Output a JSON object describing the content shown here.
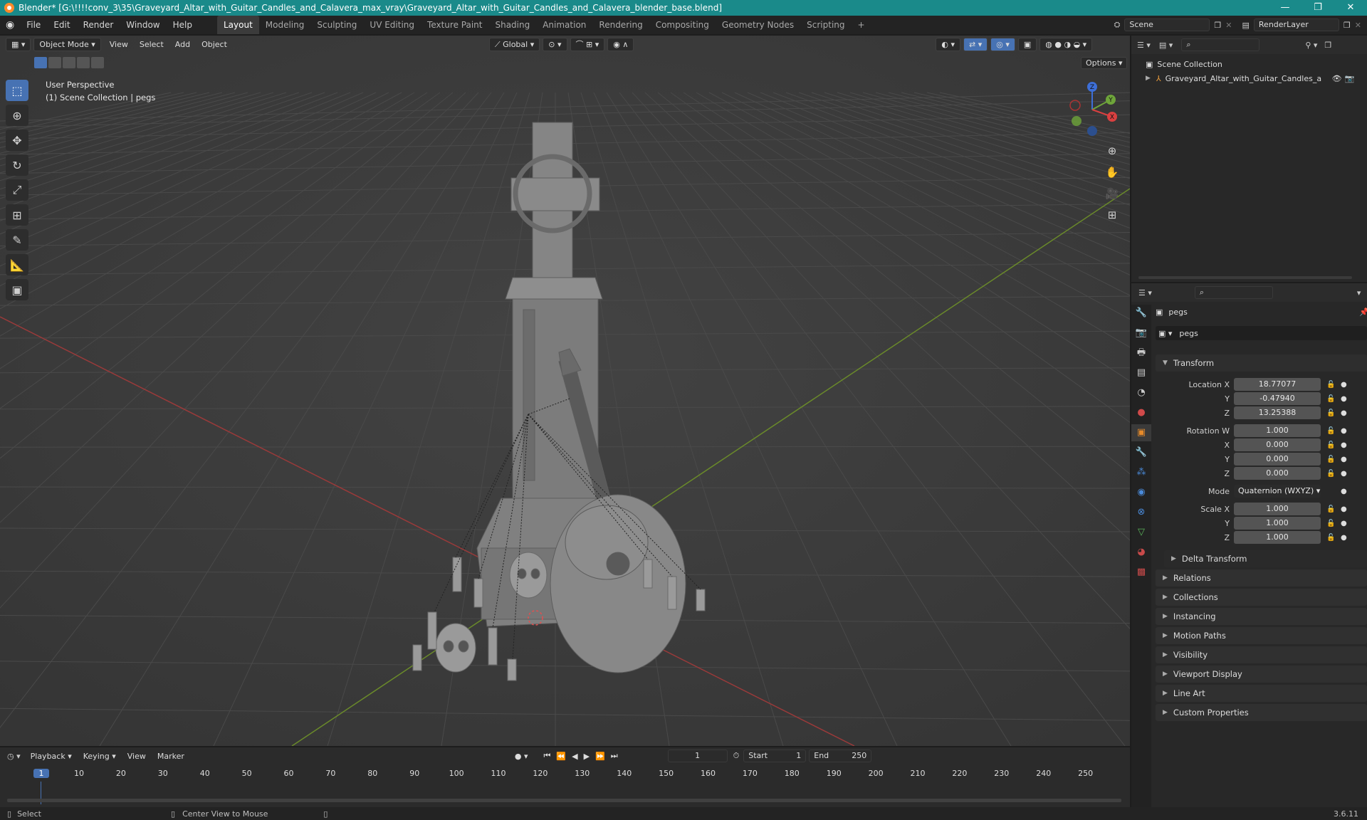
{
  "titlebar": {
    "title": "Blender* [G:\\!!!!conv_3\\35\\Graveyard_Altar_with_Guitar_Candles_and_Calavera_max_vray\\Graveyard_Altar_with_Guitar_Candles_and_Calavera_blender_base.blend]",
    "minimize": "—",
    "maximize": "❐",
    "close": "✕"
  },
  "menubar": {
    "menus": [
      "File",
      "Edit",
      "Render",
      "Window",
      "Help"
    ],
    "workspaces": [
      "Layout",
      "Modeling",
      "Sculpting",
      "UV Editing",
      "Texture Paint",
      "Shading",
      "Animation",
      "Rendering",
      "Compositing",
      "Geometry Nodes",
      "Scripting"
    ],
    "add_workspace": "+",
    "scene": "Scene",
    "render_layer": "RenderLayer"
  },
  "viewport": {
    "mode": "Object Mode",
    "menus": [
      "View",
      "Select",
      "Add",
      "Object"
    ],
    "transform_orientation": "Global",
    "options": "Options",
    "overlay_line1": "User Perspective",
    "overlay_line2": "(1) Scene Collection | pegs",
    "gizmo": {
      "z": "Z",
      "y": "Y",
      "x": "X"
    }
  },
  "outliner": {
    "search_placeholder": "",
    "root": "Scene Collection",
    "items": [
      {
        "label": "Graveyard_Altar_with_Guitar_Candles_a"
      }
    ]
  },
  "properties": {
    "object_name": "pegs",
    "data_name": "pegs",
    "transform_title": "Transform",
    "location": {
      "label_x": "Location X",
      "label_y": "Y",
      "label_z": "Z",
      "x": "18.77077",
      "y": "-0.47940",
      "z": "13.25388"
    },
    "rotation": {
      "label_w": "Rotation W",
      "label_x": "X",
      "label_y": "Y",
      "label_z": "Z",
      "w": "1.000",
      "x": "0.000",
      "y": "0.000",
      "z": "0.000"
    },
    "mode_label": "Mode",
    "mode_value": "Quaternion (WXYZ)",
    "scale": {
      "label_x": "Scale X",
      "label_y": "Y",
      "label_z": "Z",
      "x": "1.000",
      "y": "1.000",
      "z": "1.000"
    },
    "delta_transform": "Delta Transform",
    "sections": [
      "Relations",
      "Collections",
      "Instancing",
      "Motion Paths",
      "Visibility",
      "Viewport Display",
      "Line Art",
      "Custom Properties"
    ]
  },
  "timeline": {
    "menus": [
      "Playback",
      "Keying",
      "View",
      "Marker"
    ],
    "current_frame": "1",
    "start_label": "Start",
    "start": "1",
    "end_label": "End",
    "end": "250",
    "ticks": [
      "1",
      "10",
      "20",
      "30",
      "40",
      "50",
      "60",
      "70",
      "80",
      "90",
      "100",
      "110",
      "120",
      "130",
      "140",
      "150",
      "160",
      "170",
      "180",
      "190",
      "200",
      "210",
      "220",
      "230",
      "240",
      "250"
    ]
  },
  "statusbar": {
    "select": "Select",
    "center_view": "Center View to Mouse",
    "version": "3.6.11"
  }
}
